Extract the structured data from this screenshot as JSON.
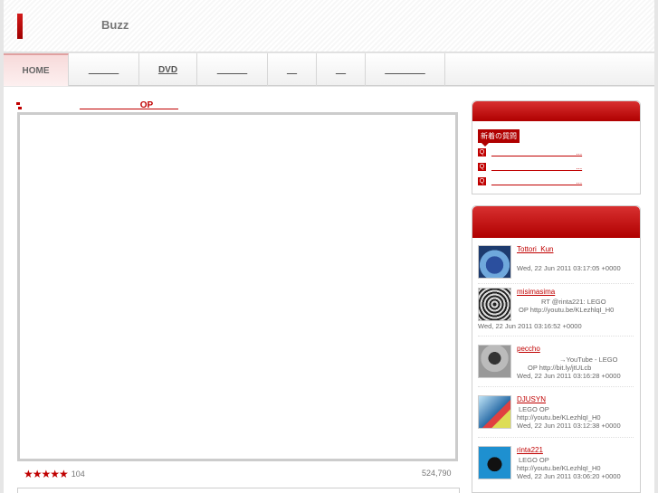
{
  "header": {
    "site_title": "Buzz"
  },
  "nav": {
    "items": [
      {
        "label": "HOME",
        "width": 72
      },
      {
        "label": "______",
        "width": 78
      },
      {
        "label": "DVD",
        "width": 64
      },
      {
        "label": "______",
        "width": 78
      },
      {
        "label": "__",
        "width": 54
      },
      {
        "label": "__",
        "width": 54
      },
      {
        "label": "________",
        "width": 88
      }
    ]
  },
  "main": {
    "video_title": "____________OP_____",
    "rating_stars": "★★★★★",
    "rating_count": "104",
    "view_count": "524,790"
  },
  "sidebar": {
    "new_questions_label": "新着の質問",
    "question_icon": "Q",
    "questions": [
      "_____________________...",
      "_____________________...",
      "_____________________..."
    ]
  },
  "tweets": [
    {
      "user": "Tottori_Kun",
      "lines": [],
      "time": "Wed, 22 Jun 2011 03:17:05 +0000"
    },
    {
      "user": "misimasima",
      "lines": [
        "RT @rinta221:  LEGO",
        "OP http://youtu.be/KLezhlqI_H0"
      ],
      "time": "Wed, 22 Jun 2011 03:16:52 +0000"
    },
    {
      "user": "peccho",
      "lines": [
        "→YouTube -  LEGO",
        "OP http://bit.ly/jtULcb"
      ],
      "time": "Wed, 22 Jun 2011 03:16:28 +0000"
    },
    {
      "user": "DJUSYN",
      "lines": [
        "LEGO          OP",
        "http://youtu.be/KLezhlqI_H0"
      ],
      "time": "Wed, 22 Jun 2011 03:12:38 +0000"
    },
    {
      "user": "rinta221",
      "lines": [
        "LEGO          OP",
        "http://youtu.be/KLezhlqI_H0"
      ],
      "time": "Wed, 22 Jun 2011 03:06:20 +0000"
    }
  ]
}
